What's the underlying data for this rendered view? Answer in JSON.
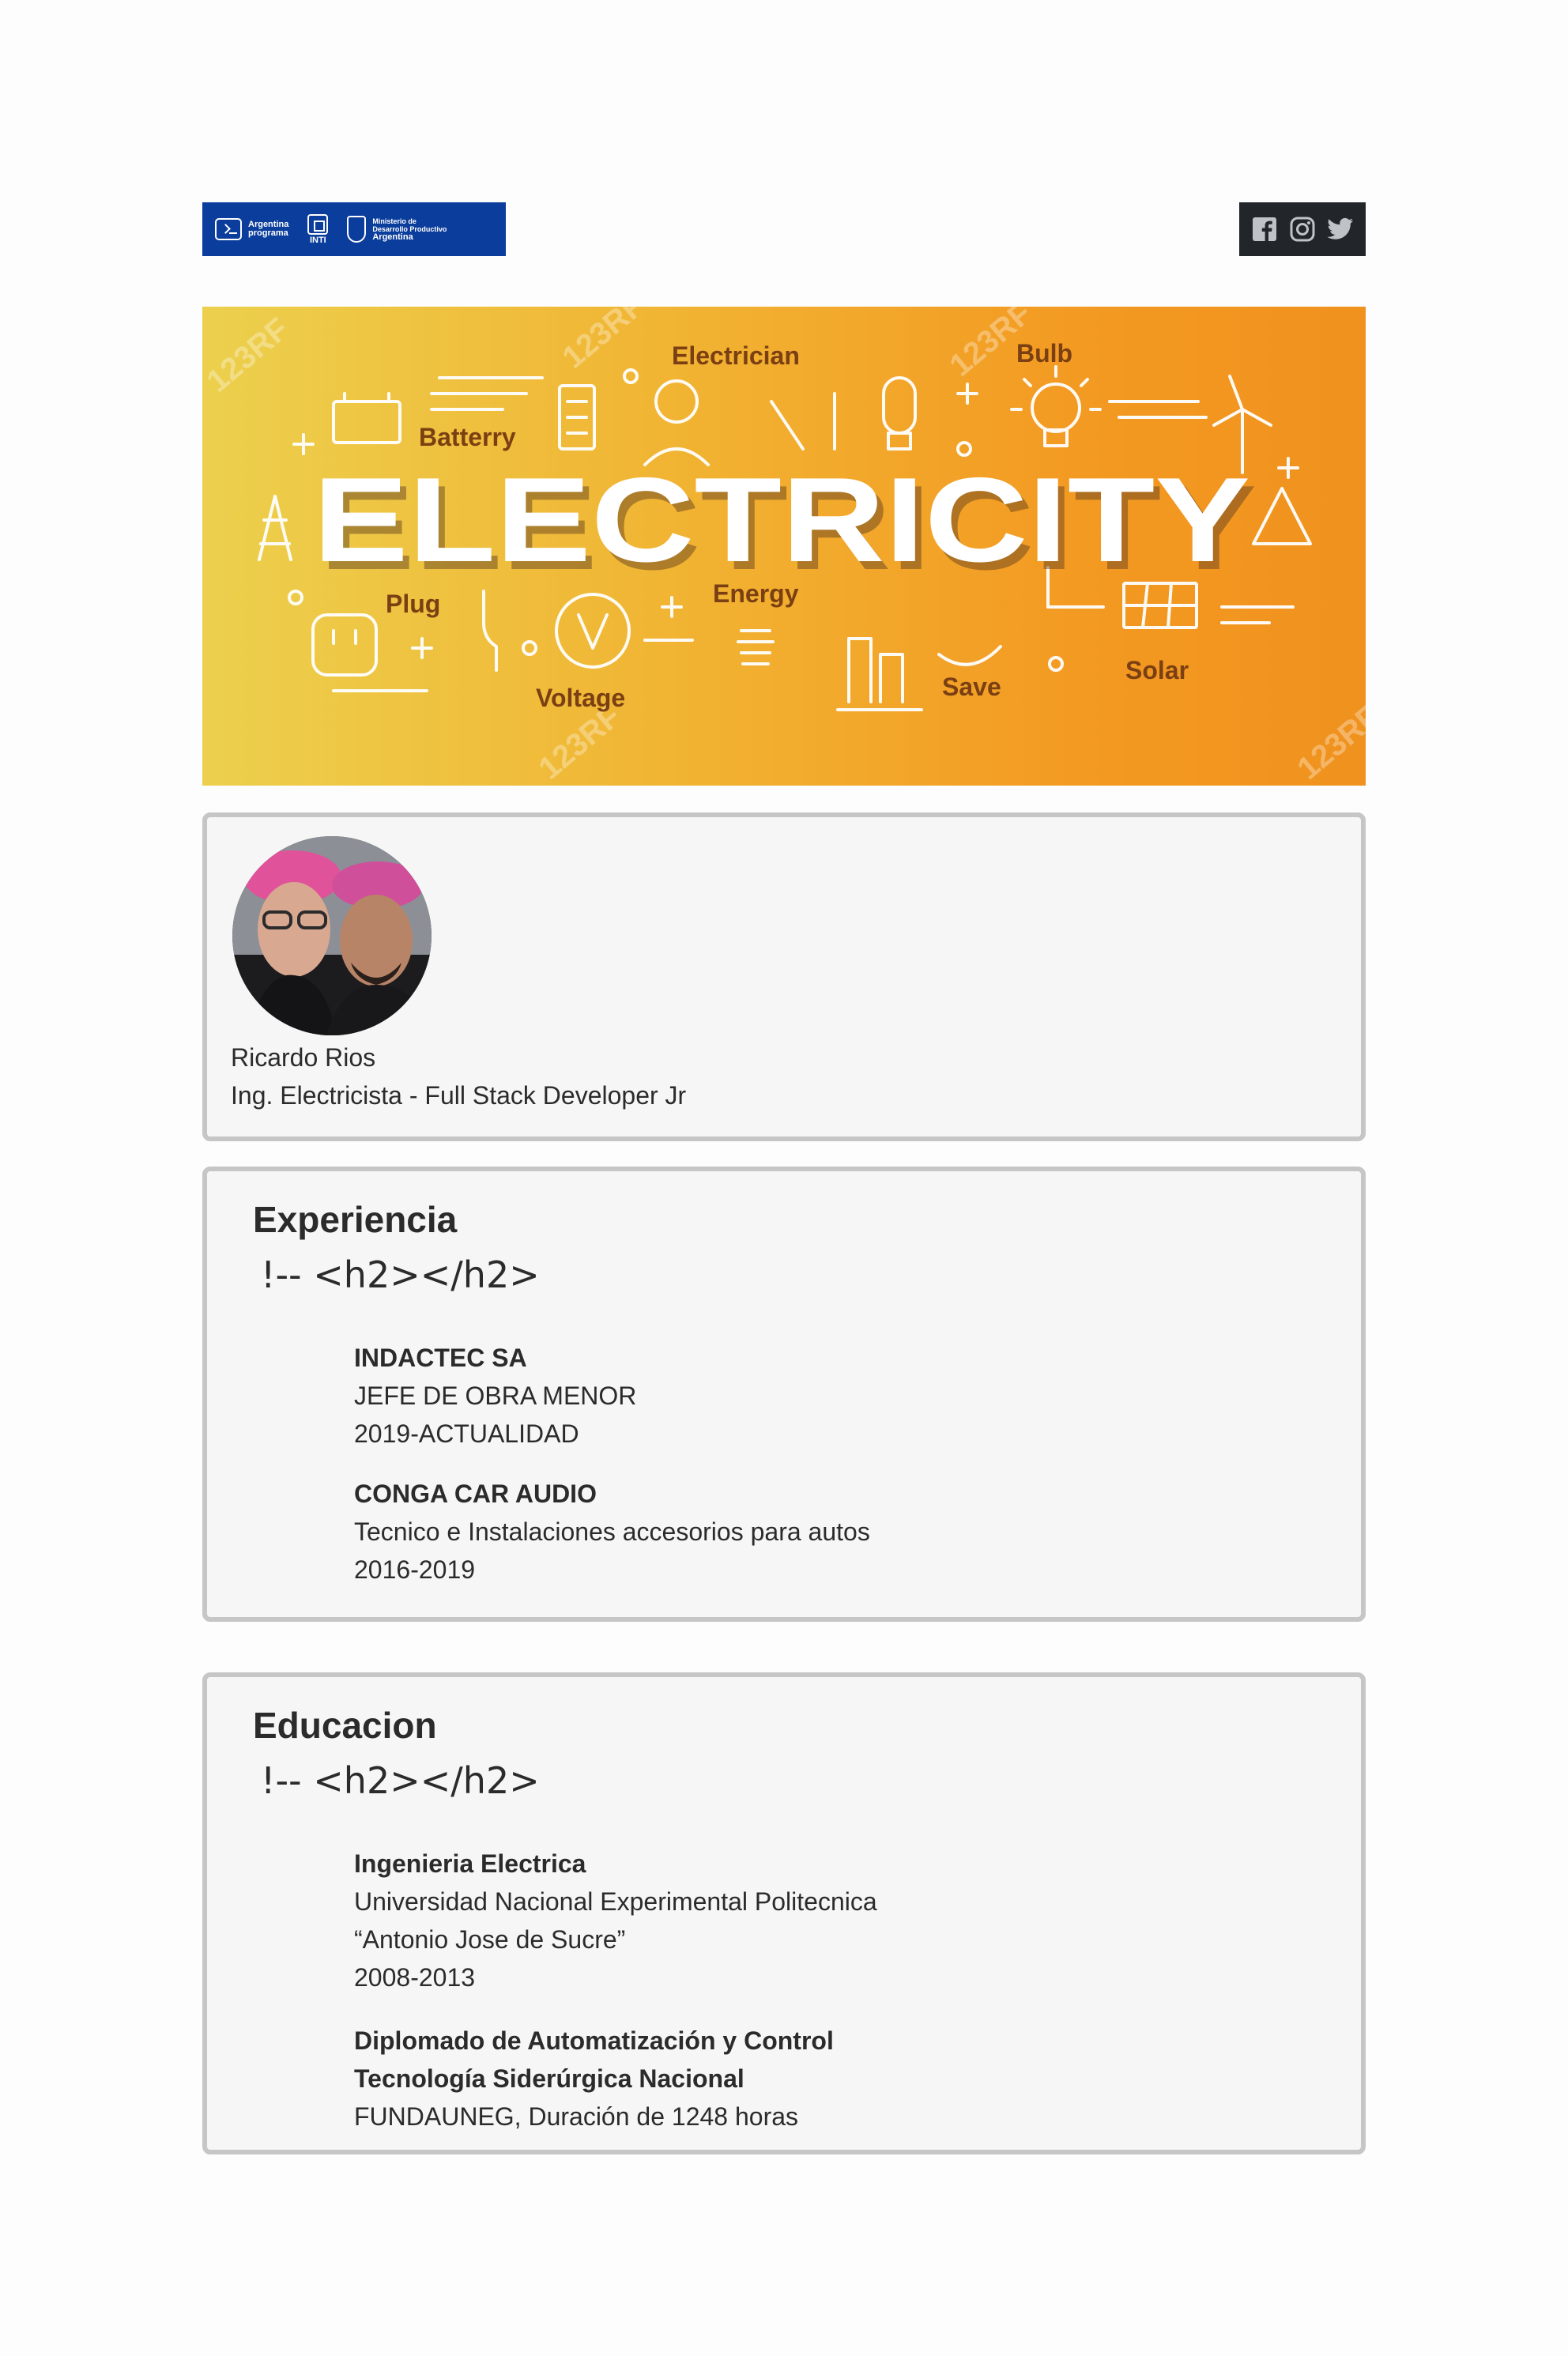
{
  "header": {
    "logo_program": [
      "Argentina",
      "programa"
    ],
    "logo_inti": "INTI",
    "logo_ministry": [
      "Ministerio de",
      "Desarrollo Productivo",
      "Argentina"
    ],
    "social_icons": [
      "facebook-icon",
      "instagram-icon",
      "twitter-icon"
    ]
  },
  "banner": {
    "title": "ELECTRICITY",
    "labels": [
      "Electrician",
      "Bulb",
      "Batterry",
      "Plug",
      "Energy",
      "Voltage",
      "Save",
      "Solar"
    ],
    "watermark": "123RF"
  },
  "profile": {
    "name": "Ricardo Rios",
    "role": "Ing. Electricista - Full Stack Developer Jr"
  },
  "experience": {
    "title": "Experiencia",
    "subtitle": "!--  <h2></h2>",
    "jobs": [
      {
        "company": "INDACTEC SA",
        "position": "JEFE DE OBRA MENOR",
        "period": "2019-ACTUALIDAD"
      },
      {
        "company": "CONGA CAR AUDIO",
        "position": "Tecnico e Instalaciones accesorios para autos",
        "period": "2016-2019"
      }
    ]
  },
  "education": {
    "title": "Educacion",
    "subtitle": "!--  <h2></h2>",
    "items": [
      {
        "degree": "Ingenieria Electrica",
        "institution_1": "Universidad Nacional Experimental Politecnica",
        "institution_2": "“Antonio Jose de Sucre”",
        "period": "2008-2013"
      },
      {
        "degree_1": "Diplomado de Automatización y Control",
        "degree_2": "Tecnología Siderúrgica Nacional",
        "detail": "FUNDAUNEG, Duración de 1248 horas"
      }
    ]
  },
  "colors": {
    "logo_bg": "#0b3d9c",
    "social_bg": "#22262b",
    "card_bg": "#f6f6f6",
    "card_border": "#c6c6c6",
    "banner_label": "#7a3f12"
  }
}
